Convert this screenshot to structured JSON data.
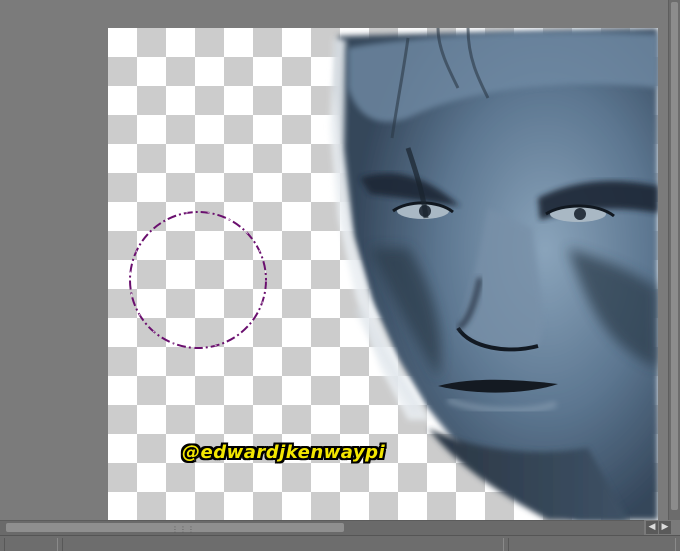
{
  "canvas": {
    "watermark": "@edwardjkenwaypi",
    "background": "transparent-checkerboard"
  },
  "brush_cursor": {
    "shape": "circle",
    "color": "#6a0f6e"
  },
  "colors": {
    "workspace": "#7b7b7b",
    "skin_main": "#5c7690",
    "skin_light": "#a5bccd",
    "skin_dark": "#1c2430",
    "watermark_fill": "#f3e600"
  },
  "scrollbars": {
    "left_arrow": "◀",
    "right_arrow": "▶",
    "grip": "⋮⋮⋮"
  }
}
